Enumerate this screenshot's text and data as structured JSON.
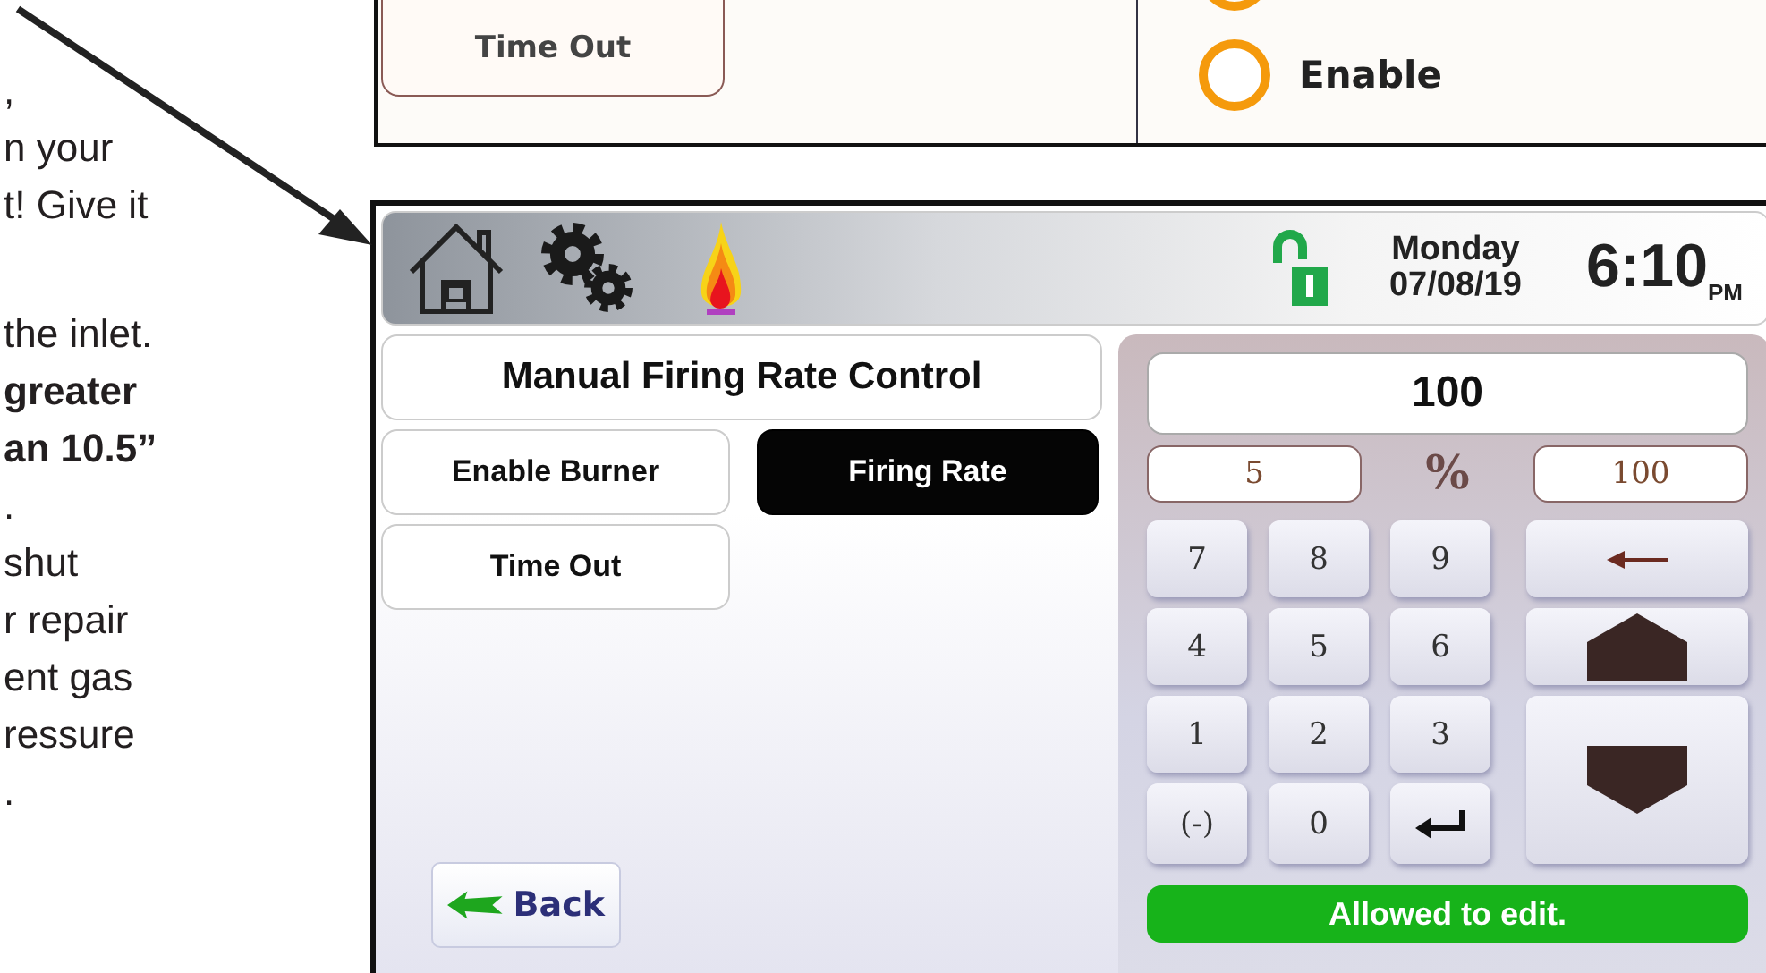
{
  "manual_text": {
    "lines": [
      {
        "text": ",",
        "bold": false,
        "gap_before": false
      },
      {
        "text": "n your",
        "bold": false,
        "gap_before": false
      },
      {
        "text": "t! Give it",
        "bold": false,
        "gap_before": false
      },
      {
        "text": "the inlet.",
        "bold": false,
        "gap_before": true
      },
      {
        "text": "greater",
        "bold": true,
        "gap_before": false
      },
      {
        "text": "an 10.5”",
        "bold": true,
        "gap_before": false
      },
      {
        "text": ".",
        "bold": false,
        "gap_before": false
      },
      {
        "text": "shut",
        "bold": false,
        "gap_before": false
      },
      {
        "text": "r repair",
        "bold": false,
        "gap_before": false
      },
      {
        "text": "ent gas",
        "bold": false,
        "gap_before": false
      },
      {
        "text": "ressure",
        "bold": false,
        "gap_before": false
      },
      {
        "text": ".",
        "bold": false,
        "gap_before": false
      }
    ]
  },
  "upper_screen": {
    "button": "Time Out",
    "options": [
      {
        "label": "Enable",
        "selected": false
      }
    ]
  },
  "screen": {
    "header": {
      "locked": false,
      "day": "Monday",
      "date": "07/08/19",
      "time": "6:10",
      "meridiem": "PM"
    },
    "title": "Manual Firing Rate Control",
    "buttons": [
      {
        "label": "Enable Burner",
        "selected": false
      },
      {
        "label": "Firing Rate",
        "selected": true
      },
      {
        "label": "Time Out",
        "selected": false
      }
    ],
    "back": "Back",
    "keypad": {
      "display": "100",
      "min": "5",
      "unit": "%",
      "max": "100",
      "keys": [
        {
          "kind": "text",
          "label": "7"
        },
        {
          "kind": "text",
          "label": "8"
        },
        {
          "kind": "text",
          "label": "9"
        },
        {
          "kind": "text",
          "label": "4"
        },
        {
          "kind": "text",
          "label": "5"
        },
        {
          "kind": "text",
          "label": "6"
        },
        {
          "kind": "text",
          "label": "1"
        },
        {
          "kind": "text",
          "label": "2"
        },
        {
          "kind": "text",
          "label": "3"
        },
        {
          "kind": "text",
          "label": "(-)"
        },
        {
          "kind": "text",
          "label": "0"
        },
        {
          "kind": "enter"
        }
      ],
      "status": {
        "text": "Allowed to edit.",
        "ok": true
      }
    }
  }
}
